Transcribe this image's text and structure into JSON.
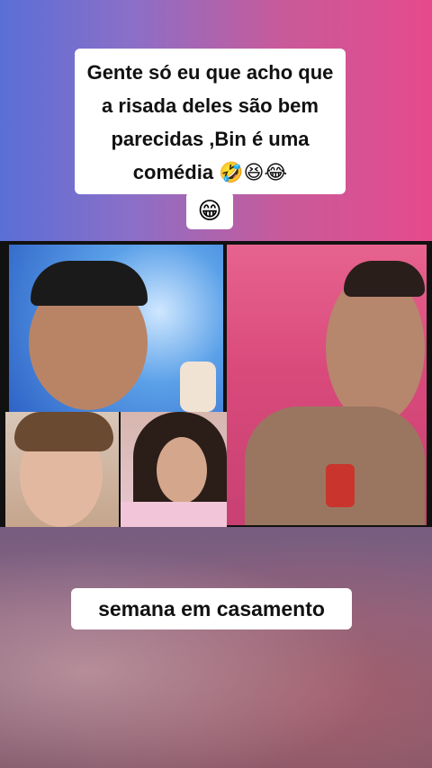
{
  "captions": {
    "top": "Gente só eu que acho que a risada deles são bem parecidas ,Bin é uma comédia 🤣😆😂",
    "emoji_line": "😁",
    "bottom": "semana em casamento"
  },
  "colors": {
    "bg_left": "#5a6fd6",
    "bg_right": "#e64a8c",
    "caption_bg": "#ffffff",
    "caption_text": "#111111"
  }
}
